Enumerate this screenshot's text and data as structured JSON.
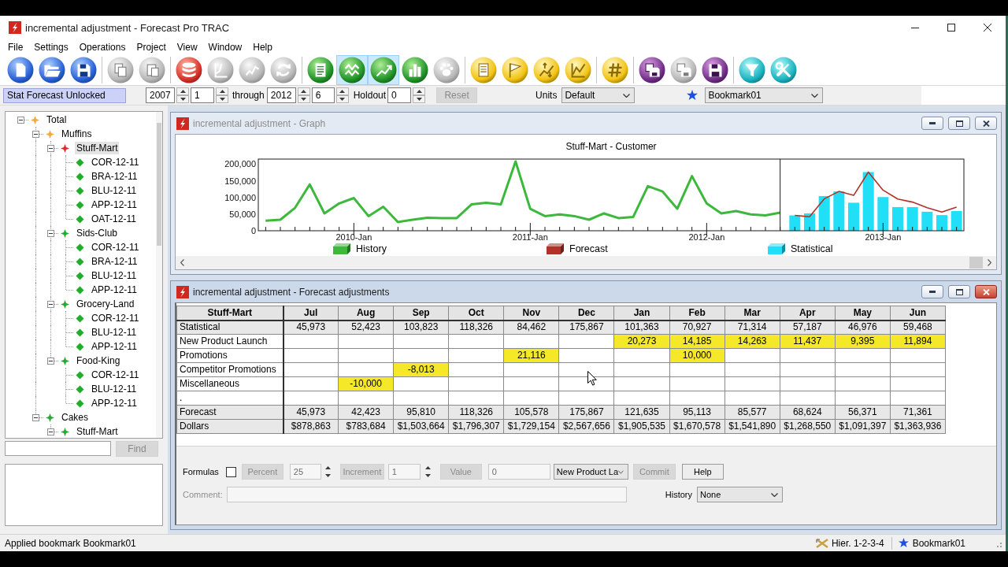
{
  "window": {
    "title": "incremental adjustment - Forecast Pro TRAC"
  },
  "menu": [
    "File",
    "Settings",
    "Operations",
    "Project",
    "View",
    "Window",
    "Help"
  ],
  "toolbar": {
    "groups": [
      [
        {
          "disabled": false,
          "selected": false
        },
        {
          "disabled": false,
          "selected": false
        },
        {
          "disabled": false,
          "selected": false
        }
      ],
      [
        {
          "disabled": true,
          "selected": false
        },
        {
          "disabled": true,
          "selected": false
        }
      ],
      [
        {
          "disabled": false,
          "selected": false
        },
        {
          "disabled": true,
          "selected": false
        },
        {
          "disabled": true,
          "selected": false
        },
        {
          "disabled": true,
          "selected": false
        }
      ],
      [
        {
          "disabled": false,
          "selected": false
        },
        {
          "disabled": false,
          "selected": true
        },
        {
          "disabled": false,
          "selected": true
        },
        {
          "disabled": false,
          "selected": false
        },
        {
          "disabled": true,
          "selected": false
        }
      ],
      [
        {
          "disabled": false,
          "selected": false
        },
        {
          "disabled": false,
          "selected": false
        },
        {
          "disabled": false,
          "selected": false
        },
        {
          "disabled": false,
          "selected": false
        }
      ],
      [
        {
          "disabled": false,
          "selected": false
        }
      ],
      [
        {
          "disabled": false,
          "selected": false
        },
        {
          "disabled": true,
          "selected": false
        },
        {
          "disabled": false,
          "selected": false
        }
      ],
      [
        {
          "disabled": false,
          "selected": false
        },
        {
          "disabled": false,
          "selected": false
        }
      ]
    ]
  },
  "options_bar": {
    "lock_status": "Stat Forecast Unlocked",
    "start_year": "2007",
    "start_period": "1",
    "through_label": "through",
    "end_year": "2012",
    "end_period": "6",
    "holdout_label": "Holdout",
    "holdout": "0",
    "reset": {
      "label": "Reset",
      "disabled": true
    },
    "units_label": "Units",
    "units": "Default",
    "bookmark": "Bookmark01"
  },
  "tree": {
    "nodes": [
      {
        "label": "Total",
        "color": "#f2a93a",
        "selected": false,
        "expanded": true,
        "children": [
          {
            "label": "Muffins",
            "color": "#f2a93a",
            "selected": false,
            "expanded": true,
            "children": [
              {
                "label": "Stuff-Mart",
                "color": "#e02a22",
                "selected": true,
                "expanded": true,
                "children": [
                  {
                    "label": "COR-12-11",
                    "color": "#1fae2a",
                    "selected": false
                  },
                  {
                    "label": "BRA-12-11",
                    "color": "#1fae2a",
                    "selected": false
                  },
                  {
                    "label": "BLU-12-11",
                    "color": "#1fae2a",
                    "selected": false
                  },
                  {
                    "label": "APP-12-11",
                    "color": "#1fae2a",
                    "selected": false
                  },
                  {
                    "label": "OAT-12-11",
                    "color": "#1fae2a",
                    "selected": false
                  }
                ]
              },
              {
                "label": "Sids-Club",
                "color": "#1fae2a",
                "selected": false,
                "expanded": true,
                "children": [
                  {
                    "label": "COR-12-11",
                    "color": "#1fae2a",
                    "selected": false
                  },
                  {
                    "label": "BRA-12-11",
                    "color": "#1fae2a",
                    "selected": false
                  },
                  {
                    "label": "BLU-12-11",
                    "color": "#1fae2a",
                    "selected": false
                  },
                  {
                    "label": "APP-12-11",
                    "color": "#1fae2a",
                    "selected": false
                  }
                ]
              },
              {
                "label": "Grocery-Land",
                "color": "#1fae2a",
                "selected": false,
                "expanded": true,
                "children": [
                  {
                    "label": "COR-12-11",
                    "color": "#1fae2a",
                    "selected": false
                  },
                  {
                    "label": "BLU-12-11",
                    "color": "#1fae2a",
                    "selected": false
                  },
                  {
                    "label": "APP-12-11",
                    "color": "#1fae2a",
                    "selected": false
                  }
                ]
              },
              {
                "label": "Food-King",
                "color": "#1fae2a",
                "selected": false,
                "expanded": true,
                "children": [
                  {
                    "label": "COR-12-11",
                    "color": "#1fae2a",
                    "selected": false
                  },
                  {
                    "label": "BLU-12-11",
                    "color": "#1fae2a",
                    "selected": false
                  },
                  {
                    "label": "APP-12-11",
                    "color": "#1fae2a",
                    "selected": false
                  }
                ]
              }
            ]
          },
          {
            "label": "Cakes",
            "color": "#1fae2a",
            "selected": false,
            "expanded": true,
            "children": [
              {
                "label": "Stuff-Mart",
                "color": "#1fae2a",
                "selected": false,
                "expanded": true
              }
            ]
          }
        ]
      }
    ],
    "find_button": {
      "label": "Find",
      "disabled": true
    }
  },
  "graph_window": {
    "title": "incremental adjustment - Graph",
    "active": false,
    "chart_data": {
      "type": "line",
      "title": "Stuff-Mart - Customer",
      "legend": "bottom",
      "categories": [
        null,
        null,
        null,
        null,
        null,
        null,
        "2010-Jan",
        null,
        null,
        null,
        null,
        null,
        null,
        null,
        null,
        null,
        null,
        null,
        "2011-Jan",
        null,
        null,
        null,
        null,
        null,
        null,
        null,
        null,
        null,
        null,
        null,
        "2012-Jan",
        null,
        null,
        null,
        null,
        null,
        null,
        null,
        null,
        null,
        null,
        null,
        "2013-Jan",
        null,
        null,
        null,
        null,
        null
      ],
      "ylim": [
        0,
        215000
      ],
      "yticks": [
        {
          "value": 0,
          "label": "0"
        },
        {
          "value": 50000,
          "label": "50,000"
        },
        {
          "value": 100000,
          "label": "100,000"
        },
        {
          "value": 150000,
          "label": "150,000"
        },
        {
          "value": 200000,
          "label": "200,000"
        }
      ],
      "series": [
        {
          "name": "History",
          "color": "#3cb83c",
          "values": [
            30000,
            33000,
            69000,
            139000,
            52000,
            82000,
            98000,
            44000,
            72000,
            26000,
            33000,
            39000,
            38000,
            38000,
            79000,
            84000,
            79000,
            208000,
            66000,
            44000,
            49000,
            44000,
            33000,
            52000,
            38000,
            41000,
            134000,
            118000,
            66000,
            164000,
            82000,
            52000,
            59000,
            49000,
            46000,
            54000,
            null,
            null,
            null,
            null,
            null,
            null,
            null,
            null,
            null,
            null,
            null,
            null
          ]
        },
        {
          "name": "Forecast",
          "color": "#b0322a",
          "values": [
            null,
            null,
            null,
            null,
            null,
            null,
            null,
            null,
            null,
            null,
            null,
            null,
            null,
            null,
            null,
            null,
            null,
            null,
            null,
            null,
            null,
            null,
            null,
            null,
            null,
            null,
            null,
            null,
            null,
            null,
            null,
            null,
            null,
            null,
            null,
            null,
            46000,
            42000,
            96000,
            118000,
            106000,
            176000,
            122000,
            95000,
            86000,
            69000,
            56000,
            71000
          ]
        },
        {
          "name": "Statistical",
          "type": "bar",
          "color": "#22dff8",
          "values": [
            null,
            null,
            null,
            null,
            null,
            null,
            null,
            null,
            null,
            null,
            null,
            null,
            null,
            null,
            null,
            null,
            null,
            null,
            null,
            null,
            null,
            null,
            null,
            null,
            null,
            null,
            null,
            null,
            null,
            null,
            null,
            null,
            null,
            null,
            null,
            null,
            46000,
            52000,
            104000,
            118000,
            84000,
            176000,
            101000,
            71000,
            71000,
            57000,
            47000,
            59000
          ]
        }
      ]
    }
  },
  "adjustments_window": {
    "title": "incremental adjustment - Forecast adjustments",
    "active": true,
    "table": {
      "corner": "Stuff-Mart",
      "columns": [
        "Jul",
        "Aug",
        "Sep",
        "Oct",
        "Nov",
        "Dec",
        "Jan",
        "Feb",
        "Mar",
        "Apr",
        "May",
        "Jun"
      ],
      "rows": [
        {
          "label": "Statistical",
          "kind": "computed",
          "cells": [
            "45,973",
            "52,423",
            "103,823",
            "118,326",
            "84,462",
            "175,867",
            "101,363",
            "70,927",
            "71,314",
            "57,187",
            "46,976",
            "59,468"
          ]
        },
        {
          "label": "New Product Launch",
          "kind": "adjustment",
          "cells": [
            null,
            null,
            null,
            null,
            null,
            null,
            "20,273",
            "14,185",
            "14,263",
            "11,437",
            "9,395",
            "11,894"
          ]
        },
        {
          "label": "Promotions",
          "kind": "adjustment",
          "cells": [
            null,
            null,
            null,
            null,
            "21,116",
            null,
            null,
            "10,000",
            null,
            null,
            null,
            null
          ]
        },
        {
          "label": "Competitor Promotions",
          "kind": "adjustment",
          "cells": [
            null,
            null,
            "-8,013",
            null,
            null,
            null,
            null,
            null,
            null,
            null,
            null,
            null
          ]
        },
        {
          "label": "Miscellaneous",
          "kind": "adjustment",
          "cells": [
            null,
            "-10,000",
            null,
            null,
            null,
            null,
            null,
            null,
            null,
            null,
            null,
            null
          ]
        },
        {
          "label": ".",
          "kind": "adjustment",
          "cells": [
            null,
            null,
            null,
            null,
            null,
            null,
            null,
            null,
            null,
            null,
            null,
            null
          ]
        },
        {
          "label": "Forecast",
          "kind": "computed",
          "cells": [
            "45,973",
            "42,423",
            "95,810",
            "118,326",
            "105,578",
            "175,867",
            "121,635",
            "95,113",
            "85,577",
            "68,624",
            "56,371",
            "71,361"
          ]
        },
        {
          "label": "Dollars",
          "kind": "computed",
          "cells": [
            "$878,863",
            "$783,684",
            "$1,503,664",
            "$1,796,307",
            "$1,729,154",
            "$2,567,656",
            "$1,905,535",
            "$1,670,578",
            "$1,541,890",
            "$1,268,550",
            "$1,091,397",
            "$1,363,936"
          ]
        }
      ]
    },
    "form": {
      "formulas": {
        "label": "Formulas",
        "checked": false
      },
      "percent_button": {
        "label": "Percent",
        "disabled": true
      },
      "percent_field": {
        "value": "25",
        "disabled": true
      },
      "increment_button": {
        "label": "Increment",
        "disabled": true
      },
      "increment_field": {
        "value": "1",
        "disabled": true
      },
      "value_button": {
        "label": "Value",
        "disabled": true
      },
      "value_field": {
        "value": "0",
        "disabled": true
      },
      "row_select": {
        "value": "New Product La"
      },
      "commit_button": {
        "label": "Commit",
        "disabled": true
      },
      "help_button": {
        "label": "Help",
        "disabled": false
      },
      "comment": {
        "label": "Comment:",
        "disabled": true
      },
      "history": {
        "label": "History",
        "value": "None"
      }
    }
  },
  "status_bar": {
    "message": "Applied bookmark Bookmark01",
    "hierarchy": "Hier. 1-2-3-4",
    "bookmark": "Bookmark01"
  }
}
